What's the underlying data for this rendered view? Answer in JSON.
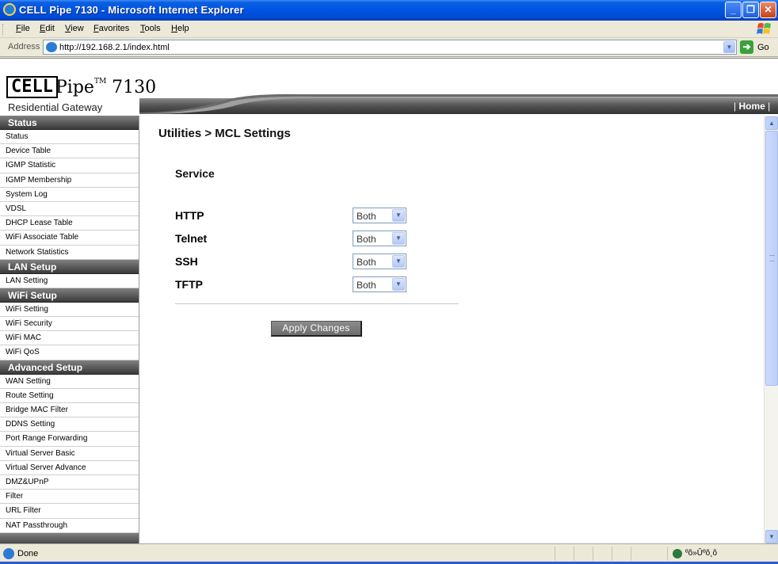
{
  "window": {
    "title": "CELL Pipe 7130 - Microsoft Internet Explorer",
    "minimize": "_",
    "maximize": "❐",
    "close": "✕"
  },
  "menu": [
    "File",
    "Edit",
    "View",
    "Favorites",
    "Tools",
    "Help"
  ],
  "address": {
    "label": "Address",
    "url": "http://192.168.2.1/index.html",
    "go_label": "Go"
  },
  "header": {
    "logo_cell": "CELL",
    "logo_pipe": "Pipe",
    "logo_tm": "TM",
    "logo_model": "7130",
    "logo_subtitle": "Residential Gateway",
    "home_label": "Home"
  },
  "sidebar": {
    "sections": [
      {
        "title": "Status",
        "items": [
          "Status",
          "Device Table",
          "IGMP Statistic",
          "IGMP Membership",
          "System Log",
          "VDSL",
          "DHCP Lease Table",
          "WiFi Associate Table",
          "Network Statistics"
        ]
      },
      {
        "title": "LAN Setup",
        "items": [
          "LAN Setting"
        ]
      },
      {
        "title": "WiFi Setup",
        "items": [
          "WiFi Setting",
          "WiFi Security",
          "WiFi MAC",
          "WiFi QoS"
        ]
      },
      {
        "title": "Advanced Setup",
        "items": [
          "WAN Setting",
          "Route Setting",
          "Bridge MAC Filter",
          "DDNS Setting",
          "Port Range Forwarding",
          "Virtual Server Basic",
          "Virtual Server Advance",
          "DMZ&UPnP",
          "Filter",
          "URL Filter",
          "NAT Passthrough"
        ]
      }
    ]
  },
  "main": {
    "breadcrumb": "Utilities > MCL Settings",
    "section_title": "Service",
    "services": [
      {
        "name": "HTTP",
        "value": "Both"
      },
      {
        "name": "Telnet",
        "value": "Both"
      },
      {
        "name": "SSH",
        "value": "Both"
      },
      {
        "name": "TFTP",
        "value": "Both"
      }
    ],
    "apply_label": "Apply Changes"
  },
  "statusbar": {
    "text": "Done",
    "zone": "ºõ»Ûºõ¸õ"
  },
  "colors": {
    "titlebar": "#0054e3",
    "nav_header": "#3a3a3a",
    "apply_button": "#7a7a7a"
  }
}
